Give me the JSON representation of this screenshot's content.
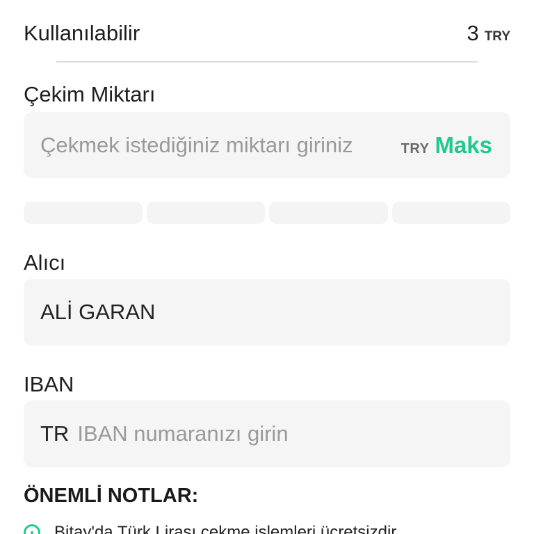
{
  "available": {
    "label": "Kullanılabilir",
    "amount": "3",
    "currency": "TRY"
  },
  "withdraw_amount": {
    "label": "Çekim Miktarı",
    "placeholder": "Çekmek istediğiniz miktarı giriniz",
    "currency": "TRY",
    "max_label": "Maks",
    "presets": [
      "",
      "",
      "",
      ""
    ]
  },
  "recipient": {
    "label": "Alıcı",
    "value": "ALİ GARAN"
  },
  "iban": {
    "label": "IBAN",
    "prefix": "TR",
    "placeholder": "IBAN numaranızı girin"
  },
  "notes": {
    "title": "ÖNEMLİ NOTLAR:",
    "items": [
      {
        "text": "Bitay'da Türk Lirası çekme işlemleri ücretsizdir.",
        "icon": "info-circle-icon"
      }
    ]
  },
  "colors": {
    "accent": "#22c98a",
    "field_bg": "#f5f5f5",
    "placeholder": "#9a9a9a"
  }
}
